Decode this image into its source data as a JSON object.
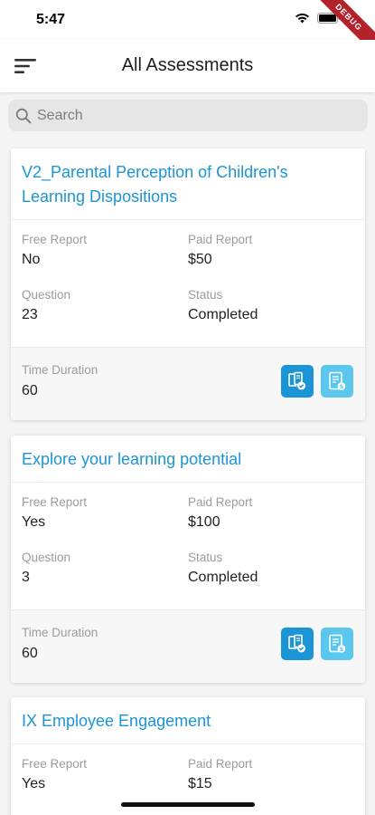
{
  "status_bar": {
    "time": "5:47",
    "debug_label": "DEBUG"
  },
  "app_bar": {
    "title": "All Assessments",
    "menu_icon": "menu-icon"
  },
  "search": {
    "placeholder": "Search",
    "value": ""
  },
  "labels": {
    "free_report": "Free Report",
    "paid_report": "Paid Report",
    "question": "Question",
    "status": "Status",
    "time_duration": "Time Duration"
  },
  "colors": {
    "accent": "#1b95d6",
    "primary_button": "#1b95d6",
    "secondary_button": "#5bc7ef"
  },
  "assessments": [
    {
      "title": "V2_Parental Perception of Children's Learning Dispositions",
      "free_report": "No",
      "paid_report": "$50",
      "question": "23",
      "status": "Completed",
      "time_duration": "60"
    },
    {
      "title": "Explore your learning potential",
      "free_report": "Yes",
      "paid_report": "$100",
      "question": "3",
      "status": "Completed",
      "time_duration": "60"
    },
    {
      "title": "IX Employee Engagement",
      "free_report": "Yes",
      "paid_report": "$15"
    }
  ]
}
